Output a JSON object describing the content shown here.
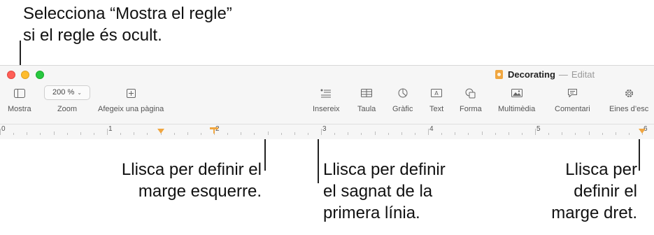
{
  "callouts": {
    "show_ruler": [
      "Selecciona “Mostra el regle”",
      "si el regle és ocult."
    ],
    "left_margin": [
      "Llisca per definir el",
      "marge esquerre."
    ],
    "first_line_indent": [
      "Llisca per definir",
      "el sagnat de la",
      "primera línia."
    ],
    "right_margin": [
      "Llisca per",
      "definir el",
      "marge dret."
    ]
  },
  "window": {
    "title": "Decorating",
    "separator": "—",
    "status": "Editat"
  },
  "toolbar": {
    "view_label": "Mostra",
    "zoom_value": "200 %",
    "zoom_label": "Zoom",
    "add_page_label": "Afegeix una pàgina",
    "insert_label": "Insereix",
    "table_label": "Taula",
    "chart_label": "Gràfic",
    "text_label": "Text",
    "shape_label": "Forma",
    "media_label": "Multimèdia",
    "comment_label": "Comentari",
    "tools_label": "Eines d’esc"
  },
  "ruler": {
    "numbers": [
      "0",
      "1",
      "2",
      "3",
      "4",
      "5",
      "6"
    ],
    "left_margin_inches": 1.5,
    "first_line_indent_inches": 2.0,
    "right_margin_inches": 6.0,
    "marker_color": "#f0a640"
  },
  "colors": {
    "close": "#ff5f57",
    "minimize": "#febc2e",
    "maximize": "#28c840",
    "accent": "#f0a640"
  },
  "icons": {
    "view": "sidebar-icon",
    "add_page": "add-page-icon",
    "insert": "insert-list-icon",
    "table": "table-icon",
    "chart": "chart-icon",
    "text": "text-box-icon",
    "shape": "shape-icon",
    "media": "image-icon",
    "comment": "comment-icon",
    "tools": "gear-icon"
  }
}
